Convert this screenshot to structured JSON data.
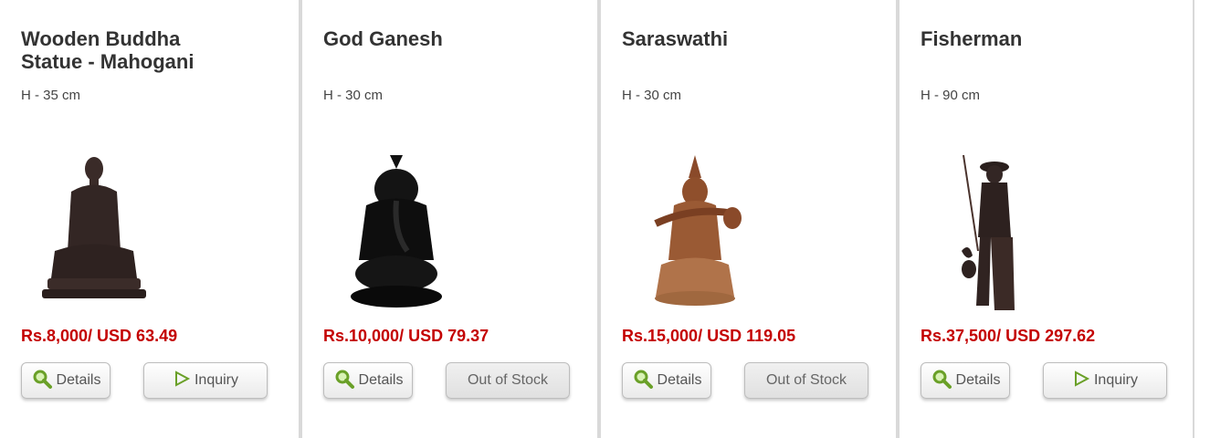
{
  "colors": {
    "price": "#c40000",
    "divider": "#d9d9d9"
  },
  "products": [
    {
      "title": "Wooden Buddha Statue - Mahogani",
      "height": "H - 35 cm",
      "price": "Rs.8,000/ USD 63.49",
      "details_label": "Details",
      "action_label": "Inquiry",
      "action_icon": "play-outline-icon",
      "image": "buddha-statue"
    },
    {
      "title": "God Ganesh",
      "height": "H - 30 cm",
      "price": "Rs.10,000/ USD 79.37",
      "details_label": "Details",
      "action_label": "Out of Stock",
      "image": "ganesh-statue"
    },
    {
      "title": "Saraswathi",
      "height": "H - 30 cm",
      "price": "Rs.15,000/ USD 119.05",
      "details_label": "Details",
      "action_label": "Out of Stock",
      "image": "saraswathi-statue"
    },
    {
      "title": "Fisherman",
      "height": "H - 90 cm",
      "price": "Rs.37,500/ USD 297.62",
      "details_label": "Details",
      "action_label": "Inquiry",
      "action_icon": "play-outline-icon",
      "image": "fisherman-statue"
    }
  ]
}
